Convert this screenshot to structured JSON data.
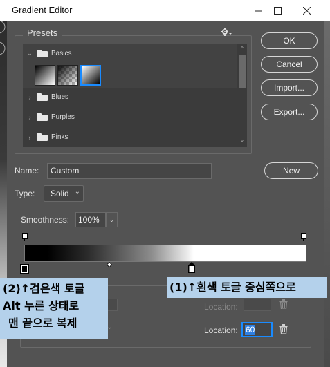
{
  "window": {
    "title": "Gradient Editor",
    "controls": {
      "minimize_icon": "minimize-icon",
      "maximize_icon": "maximize-icon",
      "close_icon": "close-icon"
    }
  },
  "presets": {
    "label": "Presets",
    "gear_icon": "gear-icon",
    "folders": [
      {
        "name": "Basics",
        "expanded": true
      },
      {
        "name": "Blues",
        "expanded": false
      },
      {
        "name": "Purples",
        "expanded": false
      },
      {
        "name": "Pinks",
        "expanded": false
      }
    ],
    "swatches": [
      "black-to-white",
      "black-to-transparent",
      "white-to-black"
    ],
    "selected_swatch": 2
  },
  "buttons": {
    "ok": "OK",
    "cancel": "Cancel",
    "import": "Import...",
    "export": "Export...",
    "new": "New"
  },
  "form": {
    "name_label": "Name:",
    "name_value": "Custom",
    "type_label": "Type:",
    "type_value": "Solid",
    "smoothness_label": "Smoothness:",
    "smoothness_value": "100%"
  },
  "stops": {
    "location_label": "Location:",
    "location_value": "60"
  },
  "annotations": {
    "left_lines": [
      "(2)↑검은색 토글",
      "Alt 누른 상태로",
      "맨 끝으로 복제"
    ],
    "right": "(1)↑흰색 토글 중심쪽으로"
  },
  "colors": {
    "dialog_bg": "#535353",
    "list_bg": "#3b3b3b",
    "accent": "#1a8bff",
    "annotation_bg": "#b4d1eb"
  }
}
